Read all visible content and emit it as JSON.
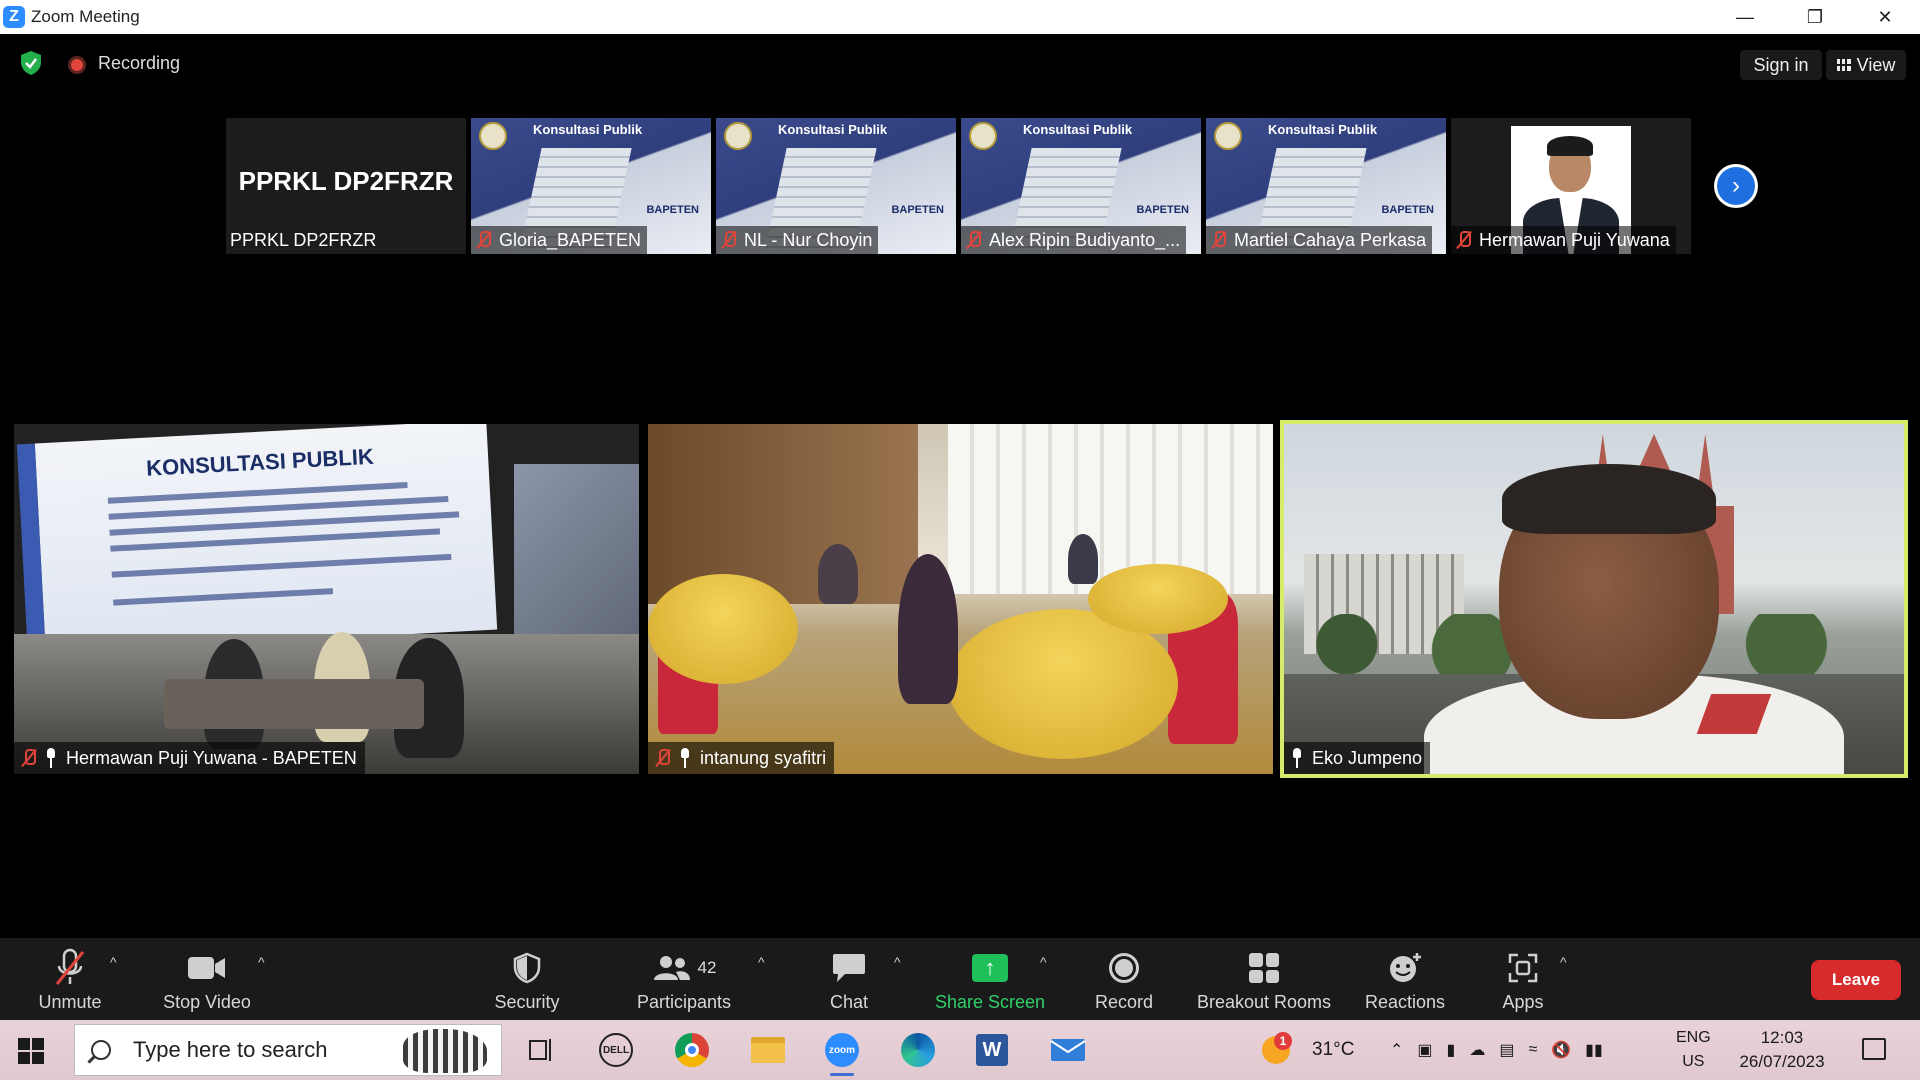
{
  "window": {
    "app_icon": "Z",
    "title": "Zoom Meeting",
    "controls": [
      "minimize-icon",
      "restore-icon",
      "close-icon"
    ]
  },
  "top_bar": {
    "recording_label": "Recording",
    "sign_in": "Sign in",
    "view": "View",
    "accent_green": "#1fbf5a",
    "record_red": "#e0443a"
  },
  "strip": {
    "thumbnails": [
      {
        "name": "PPRKL DP2FRZR",
        "display": "PPRKL DP2FRZR",
        "type": "name-only",
        "muted": false
      },
      {
        "name": "Gloria_BAPETEN",
        "type": "slide",
        "muted": true,
        "slide_title": "Konsultasi Publik",
        "slide_brand": "BAPETEN"
      },
      {
        "name": "NL - Nur Choyin",
        "type": "slide",
        "muted": true,
        "slide_title": "Konsultasi Publik",
        "slide_brand": "BAPETEN"
      },
      {
        "name": "Alex Ripin Budiyanto_...",
        "type": "slide",
        "muted": true,
        "slide_title": "Konsultasi Publik",
        "slide_brand": "BAPETEN"
      },
      {
        "name": "Martiel Cahaya Perkasa",
        "type": "slide",
        "muted": true,
        "slide_title": "Konsultasi Publik",
        "slide_brand": "BAPETEN"
      },
      {
        "name": "Hermawan Puji Yuwana",
        "type": "portrait",
        "muted": true
      }
    ],
    "next_icon": "chevron-right-icon"
  },
  "gallery": {
    "tiles": [
      {
        "name": "Hermawan Puji Yuwana - BAPETEN",
        "muted": true,
        "raised_hand": true,
        "banner_title": "KONSULTASI PUBLIK"
      },
      {
        "name": "intanung syafitri",
        "muted": true,
        "raised_hand": true
      },
      {
        "name": "Eko Jumpeno",
        "muted": false,
        "raised_hand": true,
        "active_speaker": true,
        "highlight_color": "#d6ec6a"
      }
    ]
  },
  "toolbar": {
    "unmute": "Unmute",
    "stop_video": "Stop Video",
    "security": "Security",
    "participants": "Participants",
    "participants_count": "42",
    "chat": "Chat",
    "share_screen": "Share Screen",
    "record": "Record",
    "breakout_rooms": "Breakout Rooms",
    "reactions": "Reactions",
    "apps": "Apps",
    "leave": "Leave",
    "leave_color": "#d82b2b"
  },
  "taskbar": {
    "search_placeholder": "Type here to search",
    "pinned": [
      "task-view-icon",
      "dell-icon",
      "chrome-icon",
      "file-explorer-icon",
      "zoom-icon",
      "edge-icon",
      "word-icon",
      "mail-icon"
    ],
    "weather_temp": "31°C",
    "weather_badge": "1",
    "lang_top": "ENG",
    "lang_bottom": "US",
    "time": "12:03",
    "date": "26/07/2023"
  }
}
